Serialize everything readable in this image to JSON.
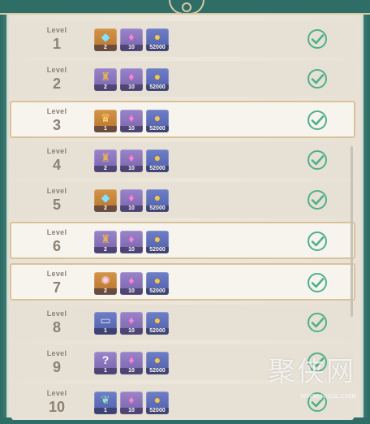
{
  "level_label": "Level",
  "rows": [
    {
      "level": "1",
      "highlight": false,
      "rewards": [
        {
          "icon": "gem-icon",
          "glyph": "◆",
          "cls": "gold g-gem",
          "count": "2"
        },
        {
          "icon": "crystal-icon",
          "glyph": "♦",
          "cls": "purple g-crystal",
          "count": "10"
        },
        {
          "icon": "coin-icon",
          "glyph": "●",
          "cls": "blue g-coin",
          "count": "52000"
        }
      ]
    },
    {
      "level": "2",
      "highlight": false,
      "rewards": [
        {
          "icon": "helmet-icon",
          "glyph": "♜",
          "cls": "purple g-helm",
          "count": "2"
        },
        {
          "icon": "crystal-icon",
          "glyph": "♦",
          "cls": "purple g-crystal",
          "count": "10"
        },
        {
          "icon": "coin-icon",
          "glyph": "●",
          "cls": "blue g-coin",
          "count": "52000"
        }
      ]
    },
    {
      "level": "3",
      "highlight": true,
      "rewards": [
        {
          "icon": "crown-icon",
          "glyph": "♛",
          "cls": "gold g-crown",
          "count": "1"
        },
        {
          "icon": "crystal-icon",
          "glyph": "♦",
          "cls": "purple g-crystal",
          "count": "10"
        },
        {
          "icon": "coin-icon",
          "glyph": "●",
          "cls": "blue g-coin",
          "count": "52000"
        }
      ]
    },
    {
      "level": "4",
      "highlight": false,
      "rewards": [
        {
          "icon": "helmet-icon",
          "glyph": "♜",
          "cls": "purple g-helm",
          "count": "2"
        },
        {
          "icon": "crystal-icon",
          "glyph": "♦",
          "cls": "purple g-crystal",
          "count": "10"
        },
        {
          "icon": "coin-icon",
          "glyph": "●",
          "cls": "blue g-coin",
          "count": "52000"
        }
      ]
    },
    {
      "level": "5",
      "highlight": false,
      "rewards": [
        {
          "icon": "gem-icon",
          "glyph": "◆",
          "cls": "gold g-gem",
          "count": "2"
        },
        {
          "icon": "crystal-icon",
          "glyph": "♦",
          "cls": "purple g-crystal",
          "count": "10"
        },
        {
          "icon": "coin-icon",
          "glyph": "●",
          "cls": "blue g-coin",
          "count": "52000"
        }
      ]
    },
    {
      "level": "6",
      "highlight": true,
      "rewards": [
        {
          "icon": "helmet-icon",
          "glyph": "♜",
          "cls": "purple g-helm",
          "count": "2"
        },
        {
          "icon": "crystal-icon",
          "glyph": "♦",
          "cls": "purple g-crystal",
          "count": "10"
        },
        {
          "icon": "coin-icon",
          "glyph": "●",
          "cls": "blue g-coin",
          "count": "52000"
        }
      ]
    },
    {
      "level": "7",
      "highlight": true,
      "rewards": [
        {
          "icon": "pearl-icon",
          "glyph": "✺",
          "cls": "gold g-pearl",
          "count": "2"
        },
        {
          "icon": "crystal-icon",
          "glyph": "♦",
          "cls": "purple g-crystal",
          "count": "10"
        },
        {
          "icon": "coin-icon",
          "glyph": "●",
          "cls": "blue g-coin",
          "count": "52000"
        }
      ]
    },
    {
      "level": "8",
      "highlight": false,
      "rewards": [
        {
          "icon": "chest-icon",
          "glyph": "▭",
          "cls": "blue g-chest",
          "count": "1"
        },
        {
          "icon": "crystal-icon",
          "glyph": "♦",
          "cls": "purple g-crystal",
          "count": "10"
        },
        {
          "icon": "coin-icon",
          "glyph": "●",
          "cls": "blue g-coin",
          "count": "52000"
        }
      ]
    },
    {
      "level": "9",
      "highlight": false,
      "rewards": [
        {
          "icon": "question-icon",
          "glyph": "?",
          "cls": "purple g-q",
          "count": "1"
        },
        {
          "icon": "crystal-icon",
          "glyph": "♦",
          "cls": "purple g-crystal",
          "count": "10"
        },
        {
          "icon": "coin-icon",
          "glyph": "●",
          "cls": "blue g-coin",
          "count": "52000"
        }
      ]
    },
    {
      "level": "10",
      "highlight": false,
      "rewards": [
        {
          "icon": "leaf-icon",
          "glyph": "❦",
          "cls": "blue g-leaf",
          "count": "1"
        },
        {
          "icon": "crystal-icon",
          "glyph": "♦",
          "cls": "purple g-crystal",
          "count": "10"
        },
        {
          "icon": "coin-icon",
          "glyph": "●",
          "cls": "blue g-coin",
          "count": "52000"
        }
      ]
    }
  ],
  "claimed_icon": "check-icon",
  "colors": {
    "check": "#4fb08a",
    "highlight_border": "#d9c29a",
    "frame": "#2f6e66"
  },
  "watermark": {
    "main": "聚侠网",
    "url": "www.juxia.com"
  }
}
